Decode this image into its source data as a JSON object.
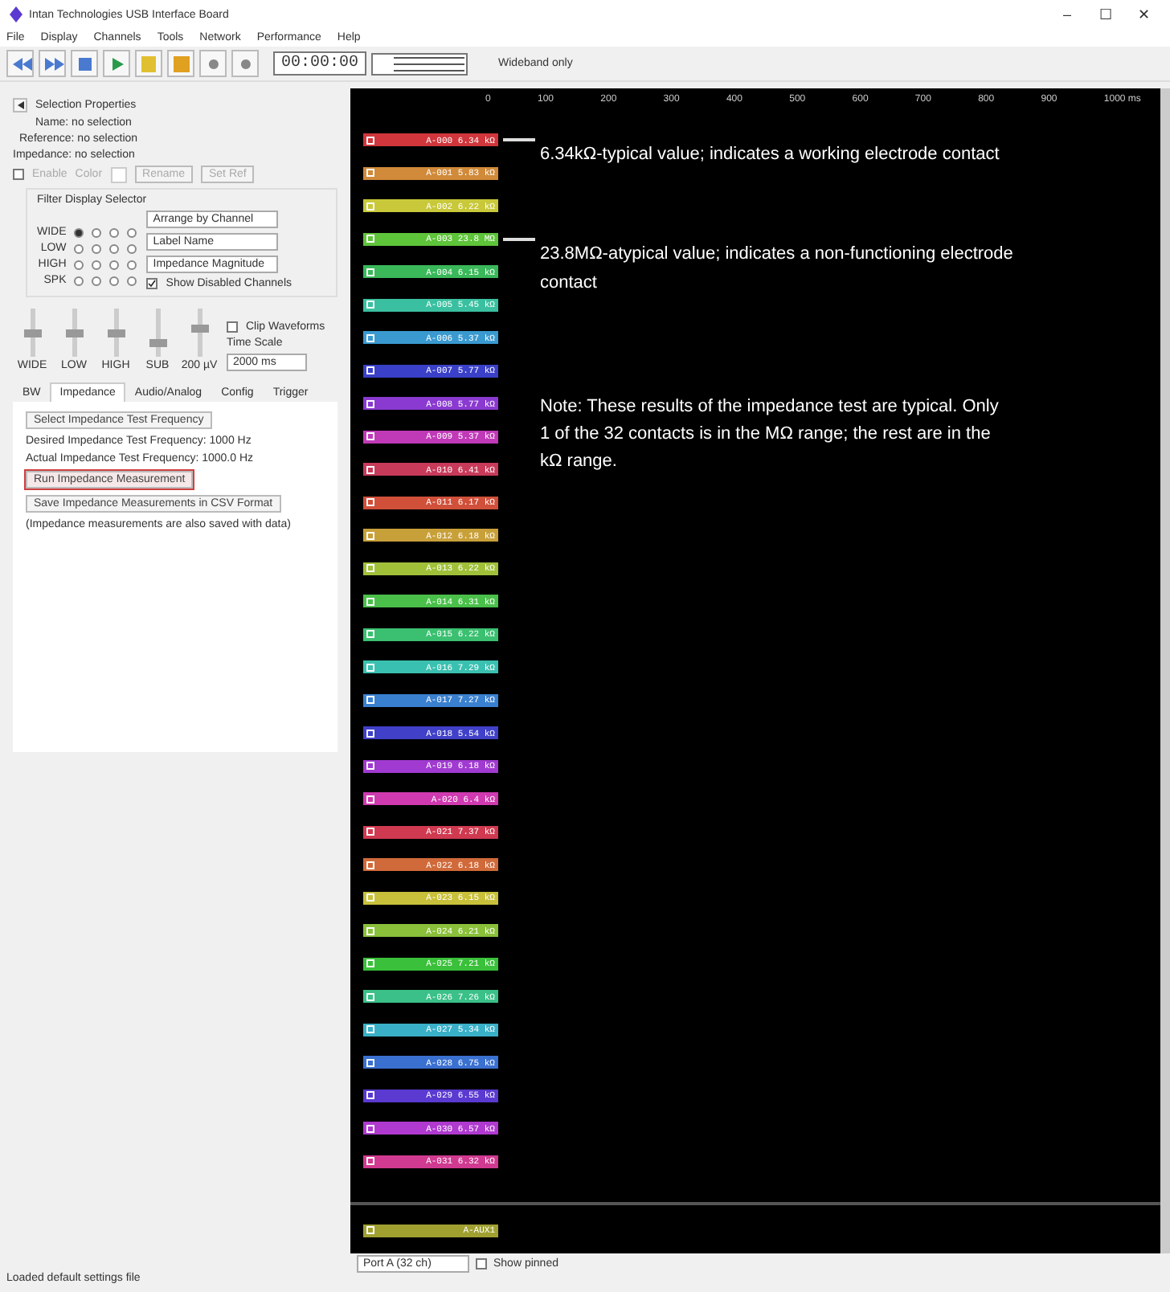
{
  "window": {
    "title": "Intan Technologies USB Interface Board",
    "controls": [
      "–",
      "☐",
      "✕"
    ]
  },
  "menu": [
    "File",
    "Display",
    "Channels",
    "Tools",
    "Network",
    "Performance",
    "Help"
  ],
  "toolbar": {
    "buttons": [
      {
        "kind": "rewind"
      },
      {
        "kind": "forward"
      },
      {
        "kind": "stop"
      },
      {
        "kind": "play"
      },
      {
        "kind": "record"
      },
      {
        "kind": "save"
      },
      {
        "kind": "dot"
      },
      {
        "kind": "dot"
      }
    ],
    "time": "00:00:00",
    "label": "Wideband only"
  },
  "selection": {
    "title": "Selection Properties",
    "name": "Name: no selection",
    "reference": "Reference: no selection",
    "impedance": "Impedance: no selection",
    "enable": {
      "label": "Enable",
      "checked": false
    },
    "color_label": "Color",
    "rename": "Rename",
    "set_ref": "Set Ref"
  },
  "filter_display": {
    "title": "Filter Display Selector",
    "rows": [
      {
        "label": "WIDE",
        "selected": [
          true,
          false,
          false,
          false
        ]
      },
      {
        "label": "LOW",
        "selected": [
          false,
          false,
          false,
          false
        ]
      },
      {
        "label": "HIGH",
        "selected": [
          false,
          false,
          false,
          false
        ]
      },
      {
        "label": "SPK",
        "selected": [
          false,
          false,
          false,
          false
        ]
      }
    ],
    "dropdowns": [
      "Arrange by Channel",
      "Label Name",
      "Impedance Magnitude"
    ],
    "show_disabled": {
      "label": "Show Disabled Channels",
      "checked": true
    }
  },
  "sliders": [
    {
      "label": "WIDE",
      "level": 0.5
    },
    {
      "label": "LOW",
      "level": 0.5
    },
    {
      "label": "HIGH",
      "level": 0.5
    },
    {
      "label": "SUB",
      "level": 0.3
    },
    {
      "label": "200 µV",
      "level": 0.6
    }
  ],
  "clip": {
    "label": "Clip Waveforms",
    "checked": false
  },
  "time_scale": {
    "label": "Time Scale",
    "value": "2000 ms"
  },
  "tabs": [
    {
      "label": "BW",
      "selected": false
    },
    {
      "label": "Impedance",
      "selected": true
    },
    {
      "label": "Audio/Analog",
      "selected": false
    },
    {
      "label": "Config",
      "selected": false
    },
    {
      "label": "Trigger",
      "selected": false
    }
  ],
  "impedance_tab": {
    "select_button": "Select Impedance Test Frequency",
    "desired": "Desired Impedance Test Frequency: 1000 Hz",
    "actual": "Actual Impedance Test Frequency: 1000.0 Hz",
    "run_button": {
      "label": "Run Impedance Measurement",
      "highlighted": true
    },
    "save_button": "Save Impedance Measurements in CSV Format",
    "note": "(Impedance measurements are also saved with data)"
  },
  "display": {
    "ruler": [
      "0",
      "100",
      "200",
      "300",
      "400",
      "500",
      "600",
      "700",
      "800",
      "900",
      "1000 ms"
    ],
    "channels": [
      {
        "label": "A-000 6.34 kΩ",
        "color": "#d0363c",
        "callout": "6.34kΩ-typical value; indicates a working electrode contact"
      },
      {
        "label": "A-001 5.83 kΩ",
        "color": "#d08a3a"
      },
      {
        "label": "A-002 6.22 kΩ",
        "color": "#c8c83a"
      },
      {
        "label": "A-003 23.8 MΩ",
        "color": "#5ec43a",
        "callout": "23.8MΩ-atypical value; indicates a non-functioning electrode contact"
      },
      {
        "label": "A-004 6.15 kΩ",
        "color": "#3ab85a"
      },
      {
        "label": "A-005 5.45 kΩ",
        "color": "#3ac0a0"
      },
      {
        "label": "A-006 5.37 kΩ",
        "color": "#3a9ad0"
      },
      {
        "label": "A-007 5.77 kΩ",
        "color": "#3a40c8"
      },
      {
        "label": "A-008 5.77 kΩ",
        "color": "#8a3ad0"
      },
      {
        "label": "A-009 5.37 kΩ",
        "color": "#c03ab8"
      },
      {
        "label": "A-010 6.41 kΩ",
        "color": "#c83a5a"
      },
      {
        "label": "A-011 6.17 kΩ",
        "color": "#d0503a"
      },
      {
        "label": "A-012 6.18 kΩ",
        "color": "#c8a03a"
      },
      {
        "label": "A-013 6.22 kΩ",
        "color": "#a0c03a"
      },
      {
        "label": "A-014 6.31 kΩ",
        "color": "#4ac04a"
      },
      {
        "label": "A-015 6.22 kΩ",
        "color": "#3ac070"
      },
      {
        "label": "A-016 7.29 kΩ",
        "color": "#3ac0b0"
      },
      {
        "label": "A-017 7.27 kΩ",
        "color": "#3a80d0"
      },
      {
        "label": "A-018 5.54 kΩ",
        "color": "#4040c8"
      },
      {
        "label": "A-019 6.18 kΩ",
        "color": "#a03ad0"
      },
      {
        "label": "A-020 6.4 kΩ",
        "color": "#d03ab0"
      },
      {
        "label": "A-021 7.37 kΩ",
        "color": "#d03a50"
      },
      {
        "label": "A-022 6.18 kΩ",
        "color": "#d06a3a"
      },
      {
        "label": "A-023 6.15 kΩ",
        "color": "#c8c03a"
      },
      {
        "label": "A-024 6.21 kΩ",
        "color": "#8ac03a"
      },
      {
        "label": "A-025 7.21 kΩ",
        "color": "#3ac03a"
      },
      {
        "label": "A-026 7.26 kΩ",
        "color": "#3ac088"
      },
      {
        "label": "A-027 5.34 kΩ",
        "color": "#3ab0c8"
      },
      {
        "label": "A-028 6.75 kΩ",
        "color": "#3a70d0"
      },
      {
        "label": "A-029 6.55 kΩ",
        "color": "#5a3ad0"
      },
      {
        "label": "A-030 6.57 kΩ",
        "color": "#b03ad0"
      },
      {
        "label": "A-031 6.32 kΩ",
        "color": "#d03a90"
      }
    ],
    "aux": {
      "label": "A-AUX1",
      "color": "#a0a030"
    },
    "note": "Note: These results of the impedance test are typical. Only 1 of the 32 contacts is in the MΩ range; the rest are in the kΩ range."
  },
  "bottom_bar": {
    "port": "Port A (32 ch)",
    "show_pinned": {
      "label": "Show pinned",
      "checked": false
    }
  },
  "status": "Loaded default settings file"
}
